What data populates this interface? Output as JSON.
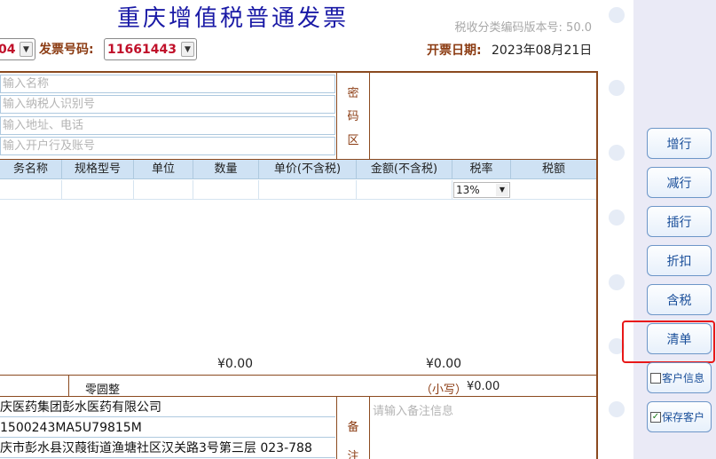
{
  "invoice": {
    "title": "重庆增值税普通发票",
    "version": "税收分类编码版本号: 50.0",
    "code_partial": "04",
    "number_label": "发票号码:",
    "number_value": "11661443",
    "date_label": "开票日期:",
    "date_value": "2023年08月21日"
  },
  "buyer": {
    "name_placeholder": "输入名称",
    "taxid_placeholder": "输入纳税人识别号",
    "address_placeholder": "输入地址、电话",
    "bank_placeholder": "输入开户行及账号"
  },
  "mima": [
    "密",
    "码",
    "区"
  ],
  "table": {
    "headers": [
      "务名称",
      "规格型号",
      "单位",
      "数量",
      "单价(不含税)",
      "金额(不含税)",
      "税率",
      "税额"
    ],
    "rate": "13%"
  },
  "totals": {
    "amount": "¥0.00",
    "tax": "¥0.00",
    "daxie": "零圆整",
    "xiaoxie_label": "（小写）",
    "xiaoxie_value": "¥0.00"
  },
  "seller": {
    "name": "庆医药集团彭水医药有限公司",
    "taxid": "1500243MA5U79815M",
    "address": "庆市彭水县汉葭街道渔塘社区汉关路3号第三层  023-788"
  },
  "beizhu": [
    "备",
    "注"
  ],
  "remark_placeholder": "请输入备注信息",
  "sidebar": {
    "buttons": [
      "增行",
      "减行",
      "插行",
      "折扣",
      "含税",
      "清单"
    ],
    "customer_info": "客户信息",
    "save_customer": "保存客户",
    "customer_info_checked": false,
    "save_customer_checked": true
  },
  "colors": {
    "title": "#1a1aa6",
    "label": "#8b3b12",
    "number": "#c0102a",
    "frame": "#8b4a1f",
    "highlight": "#e81818"
  }
}
